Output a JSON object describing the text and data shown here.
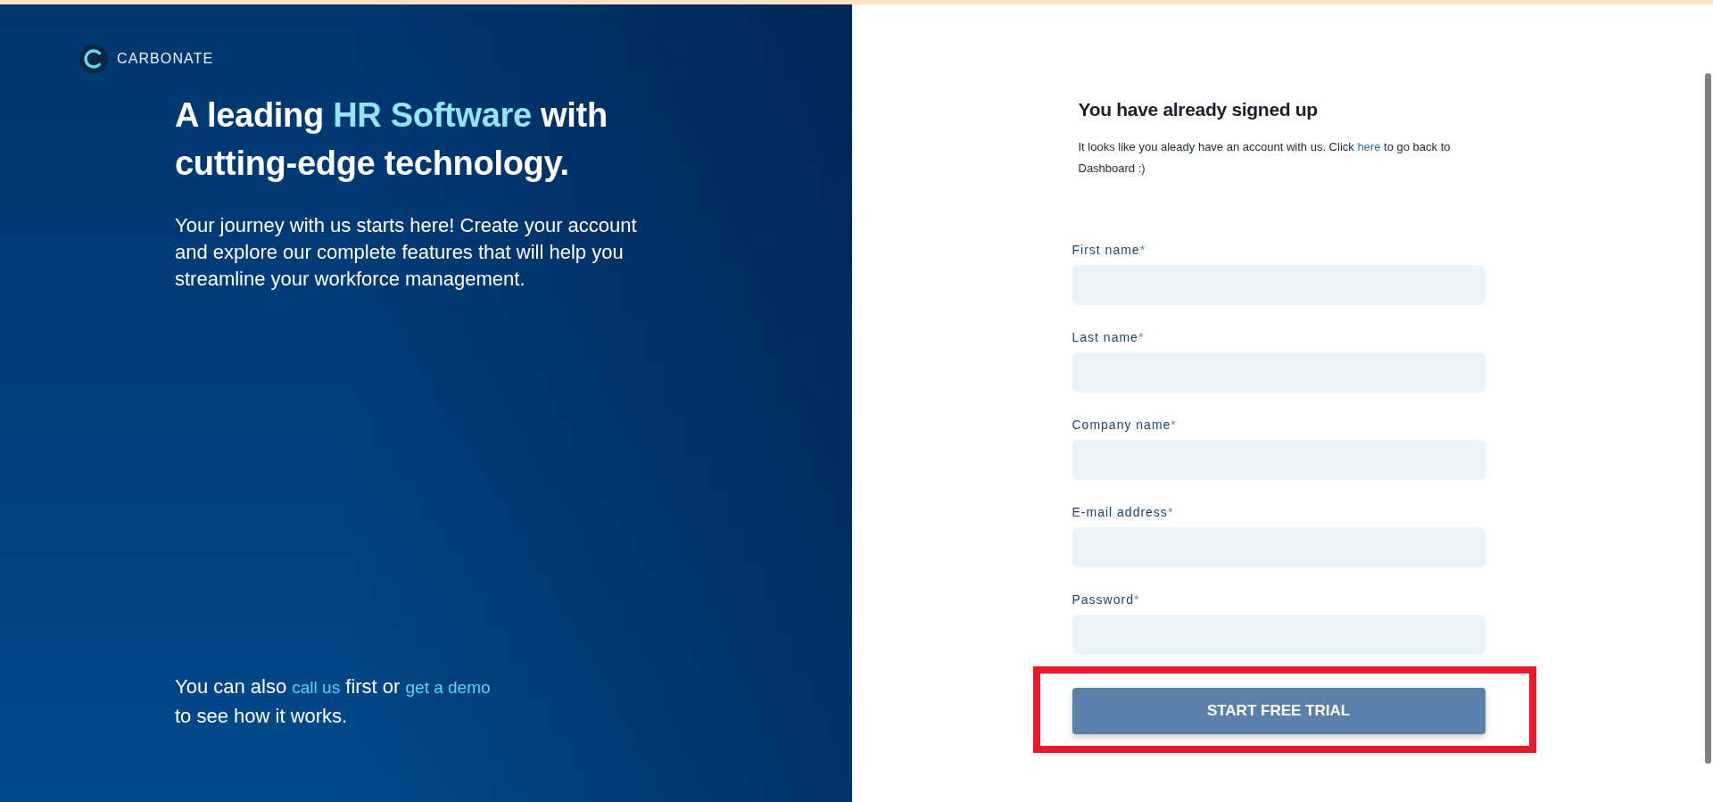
{
  "brand": {
    "name": "CARBONATE"
  },
  "hero": {
    "headline": [
      {
        "kind": "text",
        "text": "A leading "
      },
      {
        "kind": "highlight",
        "text": "HR Software"
      },
      {
        "kind": "text",
        "text": " with cutting-edge technology."
      }
    ],
    "description": "Your journey with us starts here! Create your account and explore our complete features that will help you streamline your workforce management.",
    "contact_note": {
      "lines": [
        [
          {
            "kind": "text",
            "text": "You can also "
          },
          {
            "kind": "link",
            "text": "call us"
          },
          {
            "kind": "text",
            "text": " first or "
          },
          {
            "kind": "link",
            "text": "get a demo"
          }
        ],
        [
          {
            "kind": "text",
            "text": "to see how it works."
          }
        ]
      ]
    }
  },
  "signup_notice": {
    "title": "You have already signed up",
    "message": [
      {
        "kind": "text",
        "text": "It looks like you aleady have an account with us. Click "
      },
      {
        "kind": "link",
        "text": "here"
      },
      {
        "kind": "text",
        "text": " to go back to Dashboard :)"
      }
    ]
  },
  "form": {
    "fields": [
      {
        "label": "First name",
        "required_mark": "*"
      },
      {
        "label": "Last name",
        "required_mark": "*"
      },
      {
        "label": "Company name",
        "required_mark": "*"
      },
      {
        "label": "E-mail address",
        "required_mark": "*"
      },
      {
        "label": "Password",
        "required_mark": "*"
      }
    ],
    "submit": {
      "label": "START FREE TRIAL",
      "highlighted": true
    }
  }
}
